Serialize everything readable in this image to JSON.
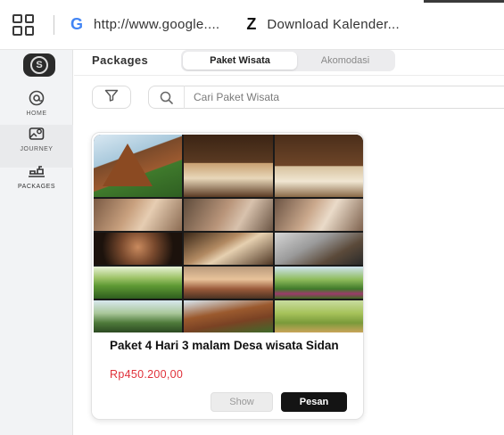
{
  "bookmarks": [
    {
      "icon": "google-g-icon",
      "glyph": "G",
      "label": "http://www.google...."
    },
    {
      "icon": "z-logo-icon",
      "glyph": "Z",
      "label": "Download Kalender..."
    }
  ],
  "sidebar": {
    "logo_glyph": "S",
    "items": [
      {
        "label": "HOME",
        "icon": "home-icon"
      },
      {
        "label": "JOURNEY",
        "icon": "journey-icon"
      },
      {
        "label": "PACKAGES",
        "icon": "packages-icon"
      }
    ]
  },
  "header": {
    "title": "Packages",
    "tabs": [
      {
        "label": "Paket Wisata",
        "active": true
      },
      {
        "label": "Akomodasi",
        "active": false
      }
    ]
  },
  "search": {
    "placeholder": "Cari Paket Wisata",
    "value": ""
  },
  "card": {
    "title": "Paket 4 Hari 3 malam Desa wisata Sidan",
    "price": "Rp450.200,00",
    "show_label": "Show",
    "order_label": "Pesan"
  },
  "colors": {
    "price": "#e0313a",
    "primary_button": "#141414",
    "sidebar_bg": "#f2f3f5"
  }
}
